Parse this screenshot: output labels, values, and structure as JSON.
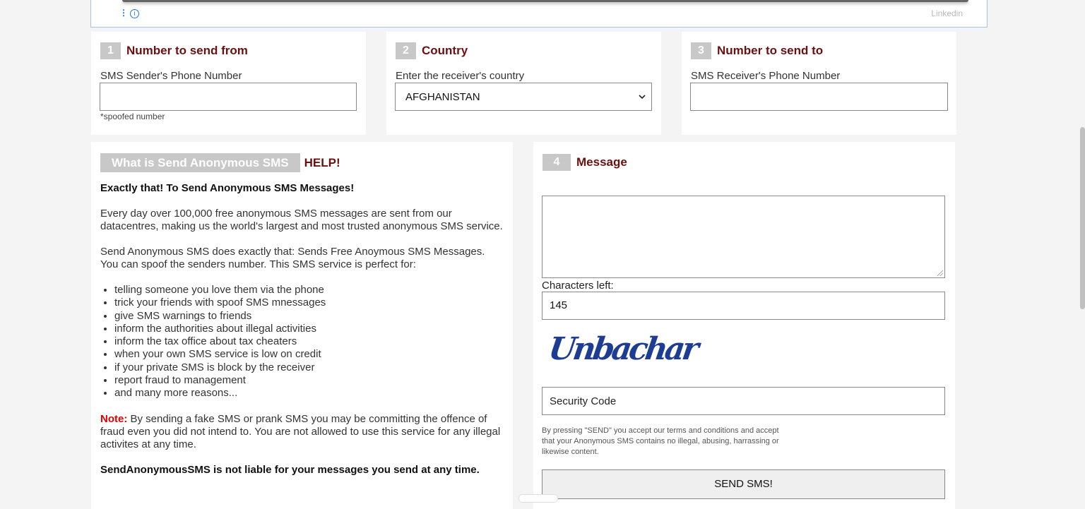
{
  "ad": {
    "link": "Linkedin"
  },
  "step1": {
    "num": "1",
    "title": "Number to send from",
    "label": "SMS Sender's Phone Number",
    "value": "",
    "note": "*spoofed number"
  },
  "step2": {
    "num": "2",
    "title": "Country",
    "label": "Enter the receiver's country",
    "selected": "AFGHANISTAN"
  },
  "step3": {
    "num": "3",
    "title": "Number to send to",
    "label": "SMS Receiver's Phone Number",
    "value": ""
  },
  "info": {
    "title": "What is Send Anonymous SMS",
    "help": "HELP!",
    "heading": "Exactly that! To Send Anonymous SMS Messages!",
    "para1": "Every day over 100,000 free anonymous SMS messages are sent from our datacentres, making us the world's largest and most trusted anonymous SMS service.",
    "para2": "Send Anonymous SMS does exactly that: Sends Free Anoymous SMS Messages. You can spoof the senders number. This SMS service is perfect for:",
    "list": [
      "telling someone you love them via the phone",
      "trick your friends with spoof SMS mnessages",
      "give SMS warnings to friends",
      "inform the authorities about illegal activities",
      "inform the tax office about tax cheaters",
      "when your own SMS service is low on credit",
      "if your private SMS is block by the receiver",
      "report fraud to management",
      "and many more reasons..."
    ],
    "note_label": "Note:",
    "note_text": " By sending a fake SMS or prank SMS you may be committing the offence of fraud even you did not intend to. You are not allowed to use this service for any illegal activites at any time.",
    "disclaimer": "SendAnonymousSMS is not liable for your messages you send at any time."
  },
  "step4": {
    "num": "4",
    "title": "Message",
    "message": "",
    "chars_label": "Characters left:",
    "chars_left": "145",
    "captcha": "Unbachar",
    "security_placeholder": "Security Code",
    "terms": "By pressing \"SEND\" you accept our terms and conditions and accept that your Anonymous SMS contains no illegal, abusing, harrassing or likewise content.",
    "send_label": "SEND SMS!"
  },
  "colors": {
    "accent": "#6b1010",
    "step_badge": "#c8c8c8",
    "note": "#e00000"
  }
}
